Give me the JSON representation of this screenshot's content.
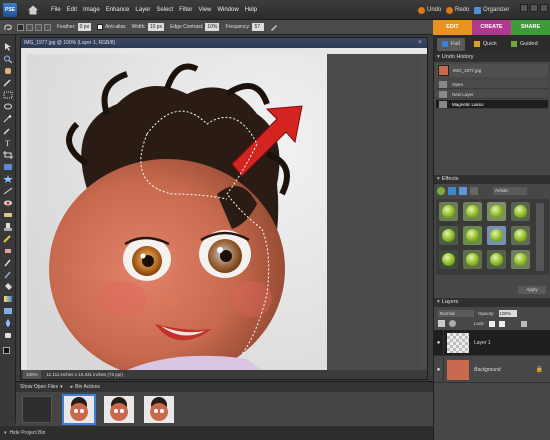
{
  "app": {
    "logo_text": "PSE",
    "menus": [
      "File",
      "Edit",
      "Image",
      "Enhance",
      "Layer",
      "Select",
      "Filter",
      "View",
      "Window",
      "Help"
    ],
    "undo_label": "Undo",
    "redo_label": "Redo",
    "organizer_label": "Organizer"
  },
  "options": {
    "feather_label": "Feather:",
    "feather_value": "0 px",
    "antialias_label": "Anti-alias",
    "width_label": "Width:",
    "width_value": "10 px",
    "edge_contrast_label": "Edge Contrast:",
    "edge_contrast_value": "10%",
    "frequency_label": "Frequency:",
    "frequency_value": "57"
  },
  "mode_tabs": {
    "edit": "EDIT",
    "create": "CREATE",
    "share": "SHARE",
    "edit_color": "#e8941e",
    "create_color": "#b0388f",
    "share_color": "#3e9b3a"
  },
  "sub_tabs": [
    "Full",
    "Quick",
    "Guided"
  ],
  "document": {
    "title": "IMG_1977.jpg @ 100% (Layer 1, RGB/8)",
    "zoom": "100%",
    "dimensions": "11.111 inches x 10.431 inches (72 ppi)"
  },
  "project_bin": {
    "show_open_files_label": "Show Open Files",
    "bin_actions_label": "Bin Actions",
    "hide_bin_label": "Hide Project Bin"
  },
  "undo_history": {
    "title": "Undo History",
    "file_name": "IMG_1977.jpg",
    "items": [
      "Open",
      "New Layer",
      "Magnetic Lasso"
    ]
  },
  "effects": {
    "title": "Effects",
    "dropdown": "Artistic",
    "apply_label": "Apply"
  },
  "layers": {
    "title": "Layers",
    "blend_mode": "Normal",
    "opacity_label": "Opacity:",
    "opacity_value": "100%",
    "lock_label": "Lock:",
    "items": [
      "Layer 1",
      "Background"
    ]
  }
}
